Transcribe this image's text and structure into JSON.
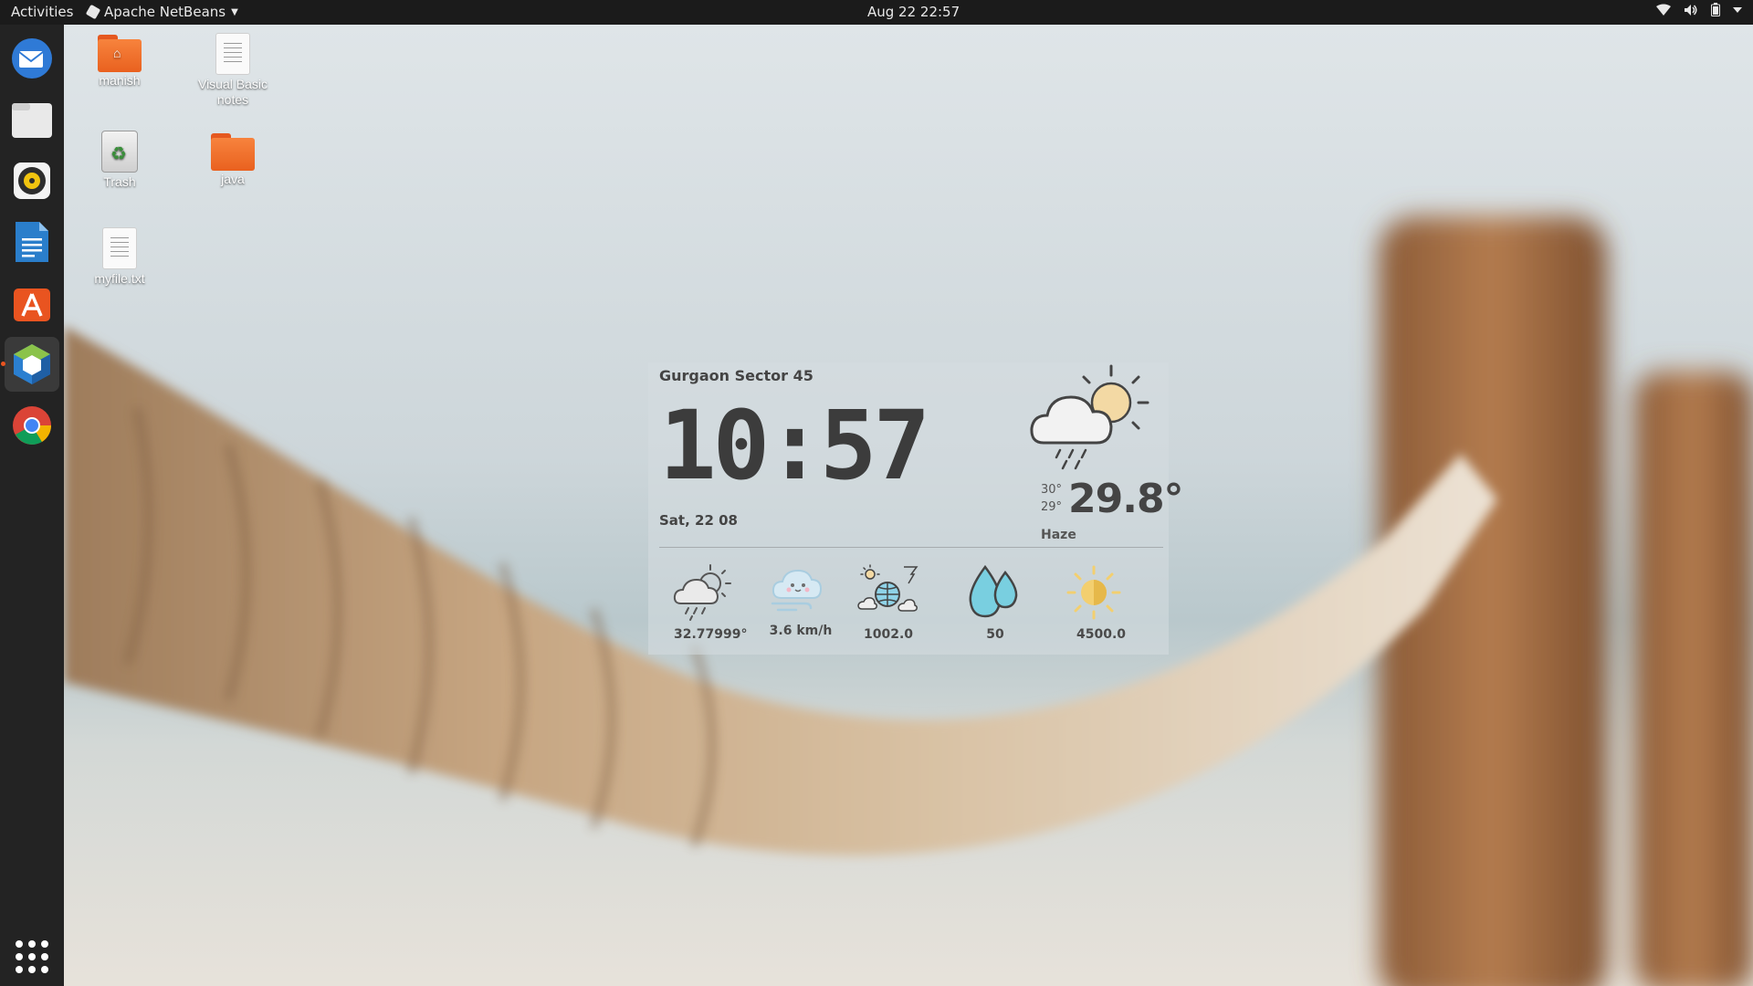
{
  "topbar": {
    "activities": "Activities",
    "app_name": "Apache NetBeans",
    "datetime": "Aug 22  22:57",
    "tray_icons": [
      "wifi-icon",
      "volume-icon",
      "battery-icon",
      "system-menu-caret"
    ]
  },
  "dock": {
    "items": [
      {
        "name": "thunderbird-icon",
        "active": false
      },
      {
        "name": "files-icon",
        "active": false
      },
      {
        "name": "rhythmbox-icon",
        "active": false
      },
      {
        "name": "libreoffice-writer-icon",
        "active": false
      },
      {
        "name": "ubuntu-software-icon",
        "active": false
      },
      {
        "name": "netbeans-icon",
        "active": true
      },
      {
        "name": "chrome-icon",
        "active": false
      }
    ],
    "show_apps": "show-applications-icon"
  },
  "desktop": {
    "icons": [
      {
        "label": "manish",
        "kind": "home-folder-icon"
      },
      {
        "label": "Visual Basic notes",
        "kind": "text-file-icon"
      },
      {
        "label": "Trash",
        "kind": "trash-icon"
      },
      {
        "label": "java",
        "kind": "folder-icon"
      },
      {
        "label": "myfile.txt",
        "kind": "text-file-icon"
      }
    ]
  },
  "weather": {
    "location": "Gurgaon Sector 45",
    "time": "10:57",
    "date": "Sat, 22 08",
    "high": "30°",
    "low": "29°",
    "temperature": "29.8°",
    "condition": "Haze",
    "stats": {
      "feels": "32.77999°",
      "wind": "3.6 km/h",
      "pressure": "1002.0",
      "humidity": "50",
      "visibility": "4500.0"
    }
  },
  "colors": {
    "topbar": "#1b1b1b",
    "dock": "#232323",
    "accent": "#e95420",
    "folder": "#f06a2a"
  }
}
